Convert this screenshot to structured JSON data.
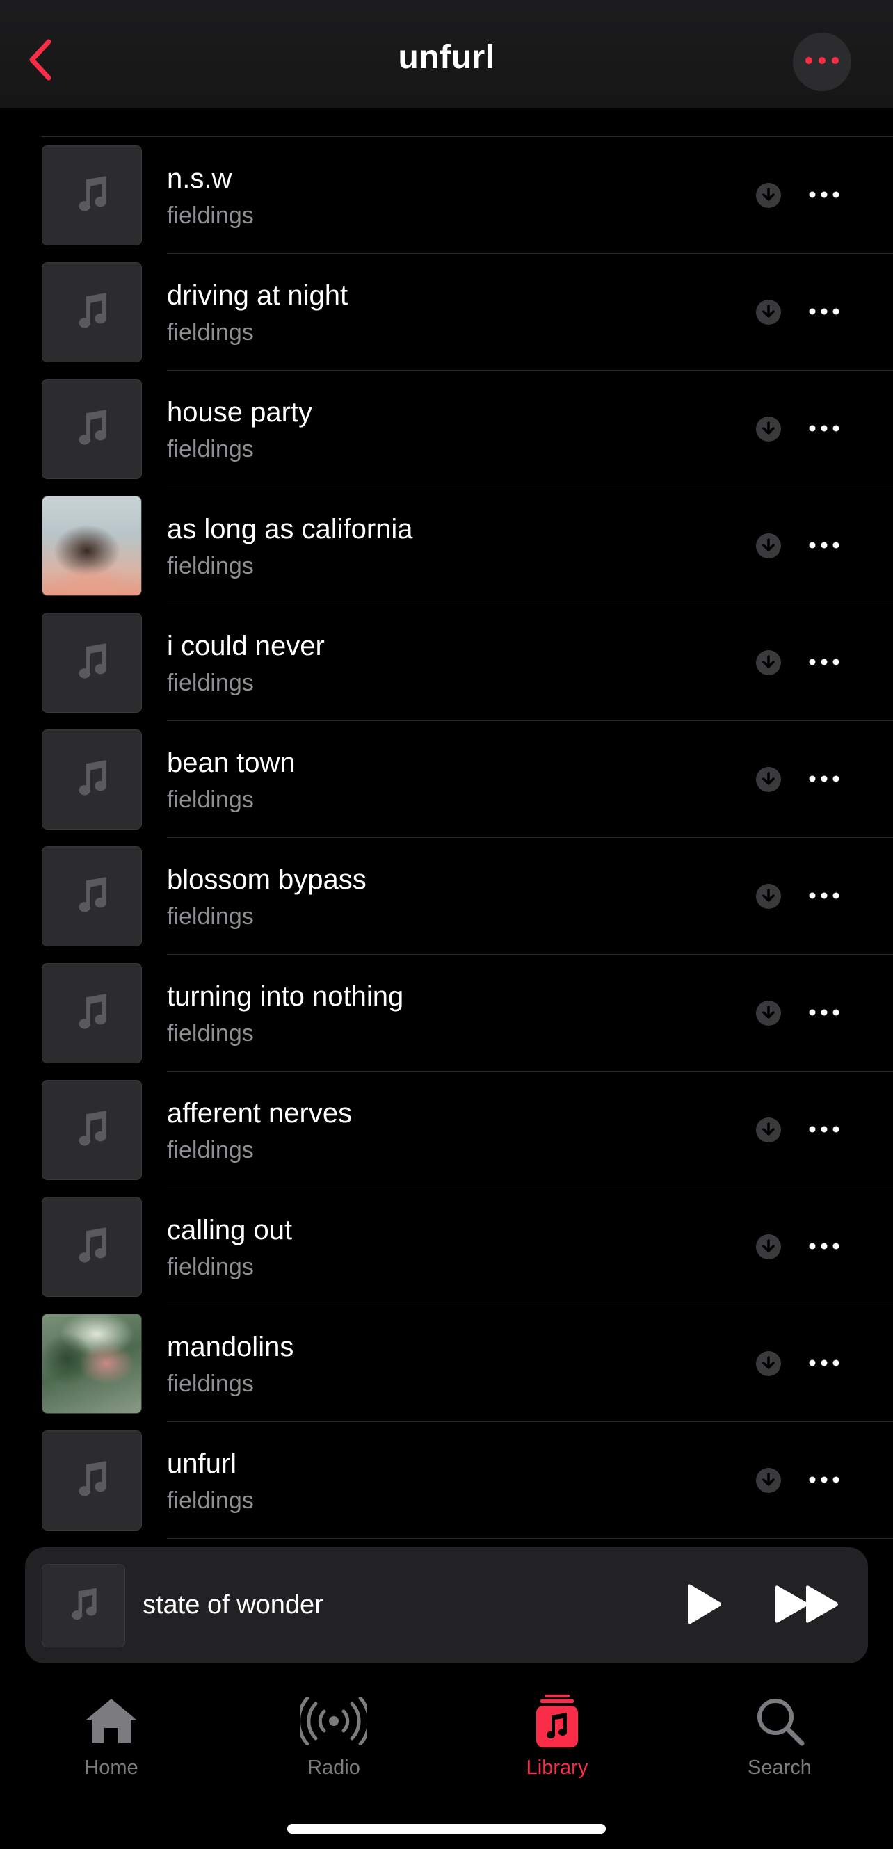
{
  "header": {
    "title": "unfurl",
    "back_icon": "chevron-left-icon",
    "more_icon": "ellipsis-icon",
    "accent_color": "#fa2d48"
  },
  "tracks": [
    {
      "title": "n.s.w",
      "artist": "fieldings",
      "artwork": "placeholder"
    },
    {
      "title": "driving at night",
      "artist": "fieldings",
      "artwork": "placeholder"
    },
    {
      "title": "house party",
      "artist": "fieldings",
      "artwork": "placeholder"
    },
    {
      "title": "as long as california",
      "artist": "fieldings",
      "artwork": "photo1"
    },
    {
      "title": "i could never",
      "artist": "fieldings",
      "artwork": "placeholder"
    },
    {
      "title": "bean town",
      "artist": "fieldings",
      "artwork": "placeholder"
    },
    {
      "title": "blossom bypass",
      "artist": "fieldings",
      "artwork": "placeholder"
    },
    {
      "title": "turning into nothing",
      "artist": "fieldings",
      "artwork": "placeholder"
    },
    {
      "title": "afferent nerves",
      "artist": "fieldings",
      "artwork": "placeholder"
    },
    {
      "title": "calling out",
      "artist": "fieldings",
      "artwork": "placeholder"
    },
    {
      "title": "mandolins",
      "artist": "fieldings",
      "artwork": "photo2"
    },
    {
      "title": "unfurl",
      "artist": "fieldings",
      "artwork": "placeholder"
    }
  ],
  "mini_player": {
    "title": "state of wonder",
    "play_icon": "play-icon",
    "forward_icon": "fast-forward-icon"
  },
  "tabs": [
    {
      "label": "Home",
      "icon": "house-icon",
      "active": false
    },
    {
      "label": "Radio",
      "icon": "broadcast-icon",
      "active": false
    },
    {
      "label": "Library",
      "icon": "music-library-icon",
      "active": true
    },
    {
      "label": "Search",
      "icon": "search-icon",
      "active": false
    }
  ]
}
